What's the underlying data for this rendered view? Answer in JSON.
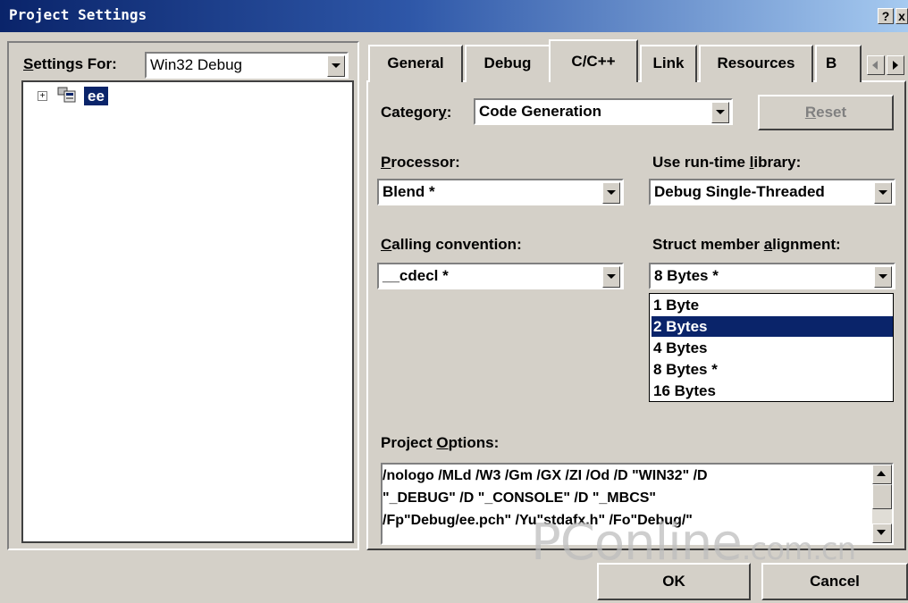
{
  "window": {
    "title": "Project Settings",
    "help_btn": "?",
    "close_btn": "x"
  },
  "settings_for": {
    "label": "Settings For:",
    "value": "Win32 Debug"
  },
  "tree": {
    "expand": "+",
    "label": "ee"
  },
  "tabs": [
    {
      "label": "General"
    },
    {
      "label": "Debug"
    },
    {
      "label": "C/C++"
    },
    {
      "label": "Link"
    },
    {
      "label": "Resources"
    },
    {
      "label": "B"
    }
  ],
  "category": {
    "label": "Category:",
    "value": "Code Generation"
  },
  "reset_label": "Reset",
  "processor": {
    "label": "Processor:",
    "value": "Blend *"
  },
  "runtime": {
    "label": "Use run-time library:",
    "value": "Debug Single-Threaded"
  },
  "calling": {
    "label": "Calling convention:",
    "value": "__cdecl *"
  },
  "alignment": {
    "label": "Struct member alignment:",
    "value": "8 Bytes *",
    "options": [
      "1 Byte",
      "2 Bytes",
      "4 Bytes",
      "8 Bytes *",
      "16 Bytes"
    ],
    "highlighted": "2 Bytes"
  },
  "project_options": {
    "label": "Project Options:",
    "text": "/nologo /MLd /W3 /Gm /GX /ZI /Od /D \"WIN32\" /D\n\"_DEBUG\" /D \"_CONSOLE\" /D \"_MBCS\"\n/Fp\"Debug/ee.pch\" /Yu\"stdafx.h\" /Fo\"Debug/\""
  },
  "buttons": {
    "ok": "OK",
    "cancel": "Cancel"
  },
  "watermark": {
    "main": "PConline",
    "suffix": ".com.cn"
  },
  "colors": {
    "selection": "#0a246a",
    "face": "#d4d0c8"
  }
}
